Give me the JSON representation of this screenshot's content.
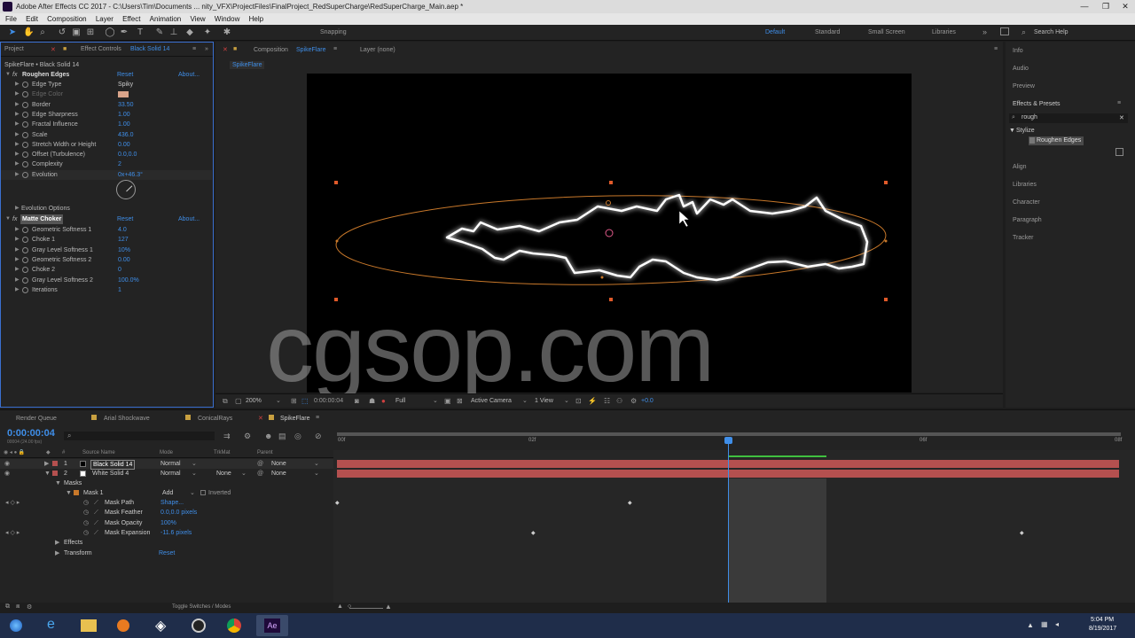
{
  "window": {
    "title": "Adobe After Effects CC 2017 - C:\\Users\\Tim\\Documents ... nity_VFX\\ProjectFiles\\FinalProject_RedSuperCharge\\RedSuperCharge_Main.aep *"
  },
  "menu": [
    "File",
    "Edit",
    "Composition",
    "Layer",
    "Effect",
    "Animation",
    "View",
    "Window",
    "Help"
  ],
  "toolbar": {
    "snapping": "Snapping",
    "workspaces": [
      "Default",
      "Standard",
      "Small Screen",
      "Libraries"
    ],
    "search_placeholder": "Search Help"
  },
  "left_panel": {
    "tab_project": "Project",
    "tab_effect_controls": "Effect Controls",
    "tab_layer": "Black Solid 14",
    "header": "SpikeFlare • Black Solid 14",
    "effect1": {
      "name": "Roughen Edges",
      "reset": "Reset",
      "about": "About..."
    },
    "effect1_props": [
      {
        "label": "Edge Type",
        "value": "Spiky"
      },
      {
        "label": "Edge Color",
        "value": ""
      },
      {
        "label": "Border",
        "value": "33.50"
      },
      {
        "label": "Edge Sharpness",
        "value": "1.00"
      },
      {
        "label": "Fractal Influence",
        "value": "1.00"
      },
      {
        "label": "Scale",
        "value": "436.0"
      },
      {
        "label": "Stretch Width or Height",
        "value": "0.00"
      },
      {
        "label": "Offset (Turbulence)",
        "value": "0.0,0.0"
      },
      {
        "label": "Complexity",
        "value": "2"
      },
      {
        "label": "Evolution",
        "value": "0x+46.3°"
      }
    ],
    "evolution_options": "Evolution Options",
    "effect2": {
      "name": "Matte Choker",
      "reset": "Reset",
      "about": "About..."
    },
    "effect2_props": [
      {
        "label": "Geometric Softness 1",
        "value": "4.0"
      },
      {
        "label": "Choke 1",
        "value": "127"
      },
      {
        "label": "Gray Level Softness 1",
        "value": "10%"
      },
      {
        "label": "Geometric Softness 2",
        "value": "0.00"
      },
      {
        "label": "Choke 2",
        "value": "0"
      },
      {
        "label": "Gray Level Softness 2",
        "value": "100.0%"
      },
      {
        "label": "Iterations",
        "value": "1"
      }
    ]
  },
  "composition": {
    "tab": "Composition",
    "name": "SpikeFlare",
    "layer_tab": "Layer (none)",
    "breadcrumb": "SpikeFlare"
  },
  "viewer_bar": {
    "zoom": "200%",
    "time": "0:00:00:04",
    "resolution": "Full",
    "camera": "Active Camera",
    "views": "1 View",
    "exposure": "+0.0"
  },
  "right_panel": {
    "items_top": [
      "Info",
      "Audio",
      "Preview",
      "Effects & Presets"
    ],
    "search": "rough",
    "category": "Stylize",
    "result": "Roughen Edges",
    "items_bottom": [
      "Align",
      "Libraries",
      "Character",
      "Paragraph",
      "Tracker"
    ]
  },
  "timeline": {
    "tabs": [
      "Render Queue",
      "Arial Shockwave",
      "ConicalRays",
      "SpikeFlare"
    ],
    "timecode": "0:00:00:04",
    "fps": "00004 (24.00 fps)",
    "columns": {
      "source": "Source Name",
      "mode": "Mode",
      "trkmat": "TrkMat",
      "parent": "Parent"
    },
    "ruler": [
      "00f",
      "02f",
      "06f",
      "08f"
    ],
    "layers": [
      {
        "num": "1",
        "name": "Black Solid 14",
        "mode": "Normal",
        "trkmat": "",
        "parent": "None"
      },
      {
        "num": "2",
        "name": "White Solid 4",
        "mode": "Normal",
        "trkmat": "None",
        "parent": "None"
      }
    ],
    "masks_label": "Masks",
    "mask1": {
      "name": "Mask 1",
      "mode": "Add",
      "inverted": "Inverted"
    },
    "mask_props": [
      {
        "label": "Mask Path",
        "value": "Shape..."
      },
      {
        "label": "Mask Feather",
        "value": "0.0,0.0 pixels"
      },
      {
        "label": "Mask Opacity",
        "value": "100%"
      },
      {
        "label": "Mask Expansion",
        "value": "-11.6 pixels"
      }
    ],
    "effects_label": "Effects",
    "transform_label": "Transform",
    "transform_reset": "Reset",
    "toggle": "Toggle Switches / Modes"
  },
  "taskbar": {
    "time": "5:04 PM",
    "date": "8/19/2017"
  },
  "watermark": "cgsop.com",
  "colors": {
    "accent": "#3f8ee8",
    "layer_red": "#b4504f",
    "mask_orange": "#c8782a"
  }
}
